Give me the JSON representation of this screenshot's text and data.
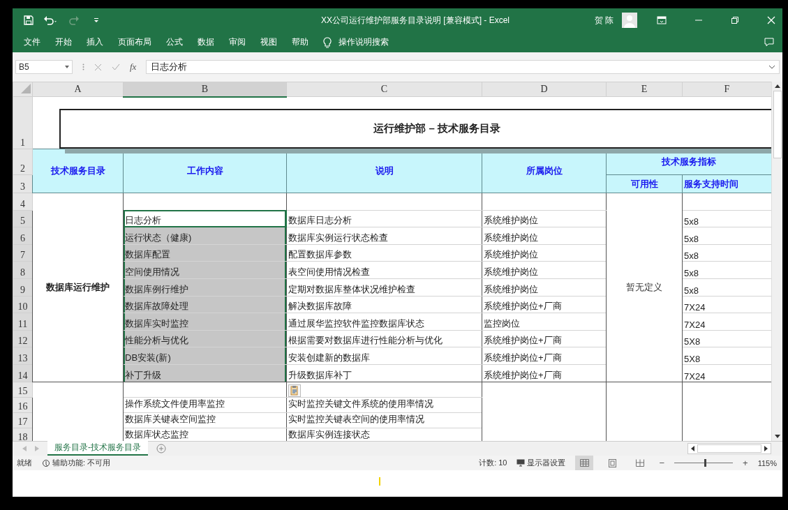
{
  "window": {
    "title": "XX公司运行维护部服务目录说明  [兼容模式]  -  Excel",
    "user": "贺 陈"
  },
  "ribbon_tabs": [
    {
      "label": "文件"
    },
    {
      "label": "开始"
    },
    {
      "label": "插入"
    },
    {
      "label": "页面布局"
    },
    {
      "label": "公式"
    },
    {
      "label": "数据"
    },
    {
      "label": "审阅"
    },
    {
      "label": "视图"
    },
    {
      "label": "帮助"
    }
  ],
  "tell_me": "操作说明搜索",
  "formula_bar": {
    "name_box": "B5",
    "function_label": "fx",
    "value": "日志分析"
  },
  "columns": [
    {
      "label": "A",
      "selected": false
    },
    {
      "label": "B",
      "selected": true
    },
    {
      "label": "C",
      "selected": false
    },
    {
      "label": "D",
      "selected": false
    },
    {
      "label": "E",
      "selected": false
    },
    {
      "label": "F",
      "selected": false
    }
  ],
  "title_rows": [
    "1",
    "2",
    "3"
  ],
  "title": "运行维护部 –   技术服务目录",
  "header": {
    "catalog": "技术服务目录",
    "work": "工作内容",
    "desc": "说明",
    "post": "所属岗位",
    "indicators": "技术服务指标",
    "availability": "可用性",
    "support_time": "服务支持时间"
  },
  "sections": [
    {
      "kind": "itemized",
      "name": "数据库运行维护",
      "availability": "暂无定义",
      "rows": [
        {
          "row": "4",
          "selected": false,
          "active": false
        },
        {
          "row": "5",
          "work": "日志分析",
          "desc": "数据库日志分析",
          "post": "系统维护岗位",
          "time": "5x8",
          "selected": true,
          "active": true
        },
        {
          "row": "6",
          "work": "运行状态（健康)",
          "desc": "数据库实例运行状态检查",
          "post": "系统维护岗位",
          "time": "5x8",
          "selected": true,
          "active": false
        },
        {
          "row": "7",
          "work": "数据库配置",
          "desc": "配置数据库参数",
          "post": "系统维护岗位",
          "time": "5x8",
          "selected": true,
          "active": false
        },
        {
          "row": "8",
          "work": "空间使用情况",
          "desc": "表空间使用情况检查",
          "post": "系统维护岗位",
          "time": "5x8",
          "selected": true,
          "active": false
        },
        {
          "row": "9",
          "work": "数据库例行维护",
          "desc": "定期对数据库整体状况维护检查",
          "post": "系统维护岗位",
          "time": "5x8",
          "selected": true,
          "active": false
        },
        {
          "row": "10",
          "work": "数据库故障处理",
          "desc": "解决数据库故障",
          "post": "系统维护岗位+厂商",
          "time": "7X24",
          "selected": true,
          "active": false
        },
        {
          "row": "11",
          "work": "数据库实时监控",
          "desc": "通过展华监控软件监控数据库状态",
          "post": "监控岗位",
          "time": "7X24",
          "selected": true,
          "active": false
        },
        {
          "row": "12",
          "work": "性能分析与优化",
          "desc": "根据需要对数据库进行性能分析与优化",
          "post": "系统维护岗位+厂商",
          "time": "5X8",
          "selected": true,
          "active": false
        },
        {
          "row": "13",
          "work": "DB安装(新)",
          "desc": "安装创建新的数据库",
          "post": "系统维护岗位+厂商",
          "time": "5X8",
          "selected": true,
          "active": false
        },
        {
          "row": "14",
          "work": "补丁升级",
          "desc": "升级数据库补丁",
          "post": "系统维护岗位+厂商",
          "time": "7X24",
          "selected": true,
          "active": false
        }
      ]
    },
    {
      "kind": "merged",
      "rows": [
        {
          "row": "15",
          "paste_icon": true,
          "selected": false,
          "active": false
        },
        {
          "row": "16",
          "work": "操作系统文件使用率监控",
          "desc": "实时监控关键文件系统的使用率情况",
          "selected": false,
          "active": false
        },
        {
          "row": "17",
          "work": "数据库关键表空间监控",
          "desc": "实时监控关键表空间的使用率情况",
          "selected": false,
          "active": false
        },
        {
          "row": "18",
          "work": "数据库状态监控",
          "desc": "数据库实例连接状态",
          "selected": false,
          "active": false
        }
      ]
    }
  ],
  "sheet_tabs": [
    {
      "label": "服务目录-技术服务目录",
      "selected": true
    }
  ],
  "status_bar": {
    "ready": "就绪",
    "accessibility": "辅助功能: 不可用",
    "count": "计数: 10",
    "display": "显示器设置",
    "views": [
      {
        "kind": "normal",
        "selected": true
      },
      {
        "kind": "page_layout",
        "selected": false
      },
      {
        "kind": "page_break",
        "selected": false
      }
    ],
    "zoom_out": "−",
    "zoom_in": "+",
    "zoom_slider": {
      "level": 0.52
    },
    "zoom": "115%"
  }
}
